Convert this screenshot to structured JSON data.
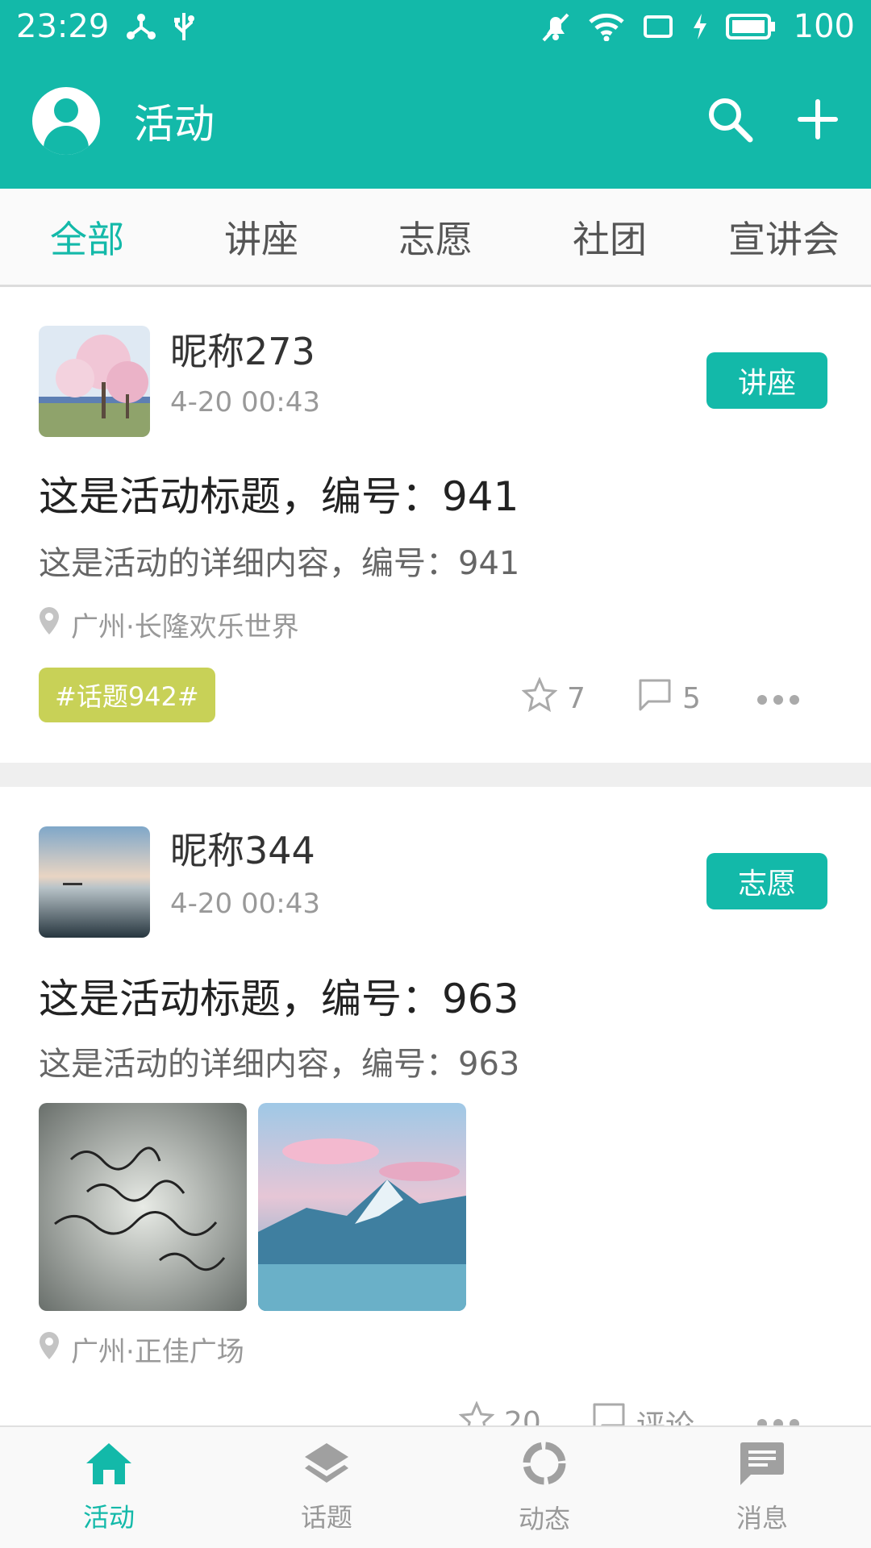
{
  "status_bar": {
    "time": "23:29",
    "battery": "100"
  },
  "app_bar": {
    "title": "活动"
  },
  "tabs": [
    {
      "label": "全部",
      "active": true
    },
    {
      "label": "讲座",
      "active": false
    },
    {
      "label": "志愿",
      "active": false
    },
    {
      "label": "社团",
      "active": false
    },
    {
      "label": "宣讲会",
      "active": false
    }
  ],
  "posts": [
    {
      "nickname": "昵称273",
      "time": "4-20 00:43",
      "category": "讲座",
      "title": "这是活动标题，编号：941",
      "content": "这是活动的详细内容，编号：941",
      "location": "广州·长隆欢乐世界",
      "topic": "#话题942#",
      "likes": "7",
      "comments": "5"
    },
    {
      "nickname": "昵称344",
      "time": "4-20 00:43",
      "category": "志愿",
      "title": "这是活动标题，编号：963",
      "content": "这是活动的详细内容，编号：963",
      "location": "广州·正佳广场",
      "likes": "20",
      "comments": "评论"
    }
  ],
  "bottom_nav": [
    {
      "label": "活动",
      "icon": "home-icon",
      "active": true
    },
    {
      "label": "话题",
      "icon": "layers-icon",
      "active": false
    },
    {
      "label": "动态",
      "icon": "circle-icon",
      "active": false
    },
    {
      "label": "消息",
      "icon": "message-icon",
      "active": false
    }
  ],
  "colors": {
    "primary": "#13b9a9",
    "topic_tag": "#c8d157"
  }
}
